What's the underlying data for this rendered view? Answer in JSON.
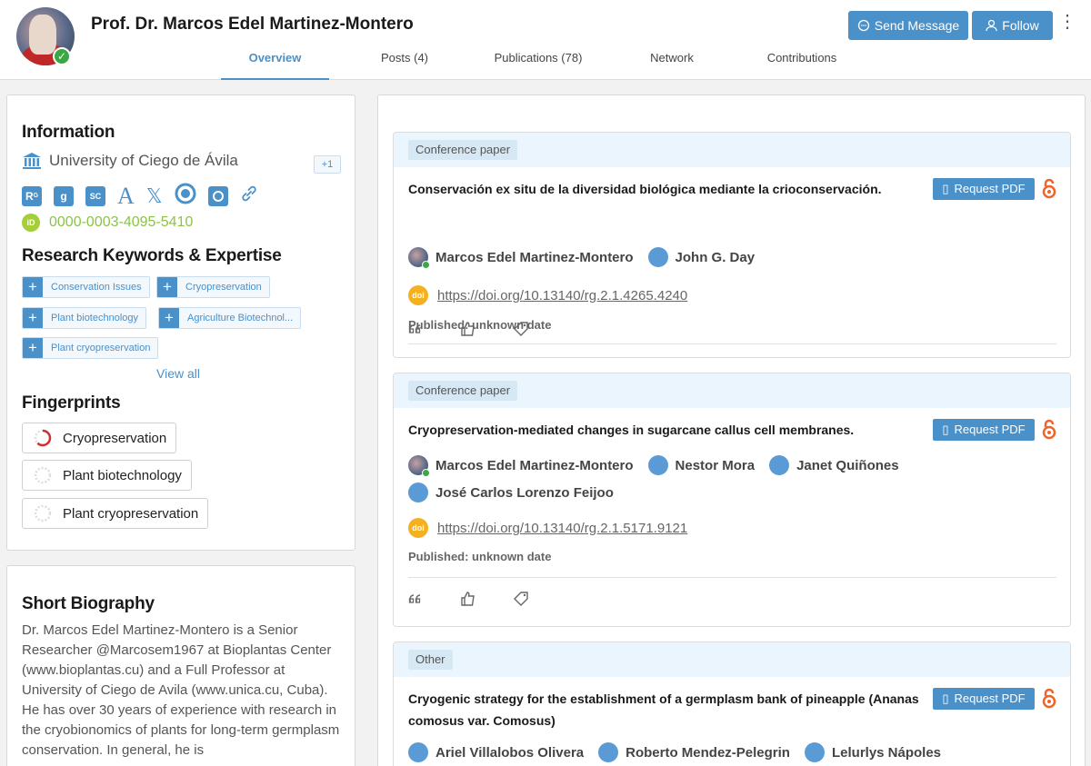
{
  "profile": {
    "name": "Prof. Dr. Marcos Edel Martinez-Montero",
    "send_message": "Send Message",
    "follow": "Follow"
  },
  "tabs": [
    {
      "label": "Overview",
      "active": true
    },
    {
      "label": "Posts (4)"
    },
    {
      "label": "Publications (78)"
    },
    {
      "label": "Network"
    },
    {
      "label": "Contributions"
    }
  ],
  "information": {
    "title": "Information",
    "institution": "University of Ciego de Ávila",
    "institution_more": "+1",
    "profiles": [
      "researchgate-icon",
      "google-scholar-icon",
      "scopus-icon",
      "academia-icon",
      "x-icon",
      "orcid-ring-icon",
      "publons-icon",
      "link-icon"
    ],
    "orcid": "0000-0003-4095-5410"
  },
  "keywords": {
    "title": "Research Keywords & Expertise",
    "items": [
      "Conservation Issues",
      "Cryopreservation",
      "Plant biotechnology",
      "Agriculture Biotechnol...",
      "Plant cryopreservation"
    ],
    "view_all": "View all"
  },
  "fingerprints": {
    "title": "Fingerprints",
    "items": [
      {
        "label": "Cryopreservation",
        "strength": 0.62
      },
      {
        "label": "Plant biotechnology",
        "strength": 0.0
      },
      {
        "label": "Plant cryopreservation",
        "strength": 0.0
      }
    ]
  },
  "biography": {
    "title": "Short Biography",
    "text": "Dr. Marcos Edel Martinez-Montero is a Senior Researcher @Marcosem1967 at Bioplantas Center (www.bioplantas.cu) and a Full Professor at University of Ciego de Avila (www.unica.cu, Cuba). He has over 30 years of experience with research in the cryobionomics of plants for long-term germplasm conservation. In general, he is"
  },
  "publications": [
    {
      "type": "Conference paper",
      "title": "Conservación ex situ de la diversidad biológica mediante la crioconservación.",
      "request_pdf": "Request PDF",
      "authors": [
        "Marcos Edel Martinez-Montero",
        "John G. Day"
      ],
      "doi": "https://doi.org/10.13140/rg.2.1.4265.4240",
      "published": "Published: unknown date"
    },
    {
      "type": "Conference paper",
      "title": "Cryopreservation-mediated changes in sugarcane callus cell membranes.",
      "request_pdf": "Request PDF",
      "authors": [
        "Marcos Edel Martinez-Montero",
        "Nestor Mora",
        "Janet Quiñones",
        "José Carlos Lorenzo Feijoo"
      ],
      "doi": "https://doi.org/10.13140/rg.2.1.5171.9121",
      "published": "Published: unknown date"
    },
    {
      "type": "Other",
      "title_line1": "Cryogenic strategy for the establishment of a germplasm bank of pineapple (Ananas",
      "title_line2": "comosus var. Comosus)",
      "request_pdf": "Request PDF",
      "authors": [
        "Ariel Villalobos Olivera",
        "Roberto Mendez-Pelegrin",
        "Lelurlys Nápoles"
      ]
    }
  ],
  "doi_badge": "doi",
  "orcid_badge": "iD",
  "colors": {
    "accent": "#4a90c9",
    "orcid": "#a6ce39",
    "open_access": "#f0642a",
    "verified": "#3aa845"
  }
}
